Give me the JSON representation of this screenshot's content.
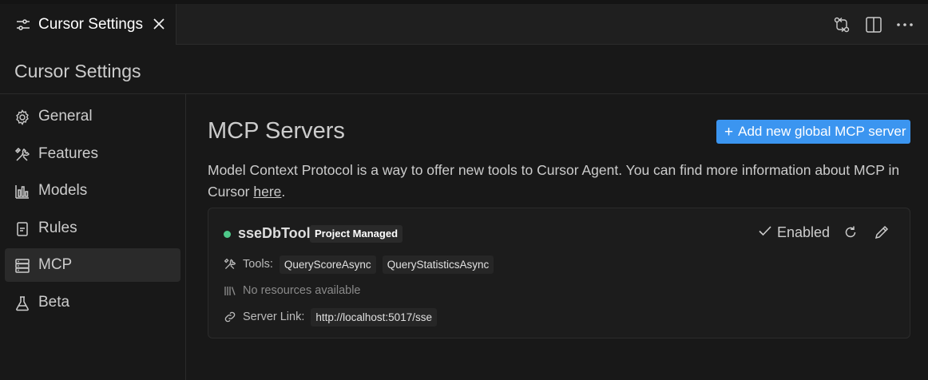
{
  "tab": {
    "title": "Cursor Settings"
  },
  "header": {
    "title": "Cursor Settings"
  },
  "sidebar": {
    "items": [
      {
        "label": "General",
        "icon": "gear-icon"
      },
      {
        "label": "Features",
        "icon": "tools-icon"
      },
      {
        "label": "Models",
        "icon": "bar-chart-icon"
      },
      {
        "label": "Rules",
        "icon": "document-icon"
      },
      {
        "label": "MCP",
        "icon": "server-icon",
        "active": true
      },
      {
        "label": "Beta",
        "icon": "flask-icon"
      }
    ]
  },
  "main": {
    "title": "MCP Servers",
    "add_button": "Add new global MCP server",
    "description": "Model Context Protocol is a way to offer new tools to Cursor Agent. You can find more information about MCP in Cursor ",
    "description_link": "here",
    "description_end": "."
  },
  "server": {
    "name": "sseDbTool",
    "badge": "Project Managed",
    "status": "Enabled",
    "status_color": "#4ec98a",
    "tools_label": "Tools:",
    "tools": [
      "QueryScoreAsync",
      "QueryStatisticsAsync"
    ],
    "resources_text": "No resources available",
    "link_label": "Server Link:",
    "link_value": "http://localhost:5017/sse"
  },
  "colors": {
    "accent": "#3b95f0",
    "background": "#181818"
  }
}
